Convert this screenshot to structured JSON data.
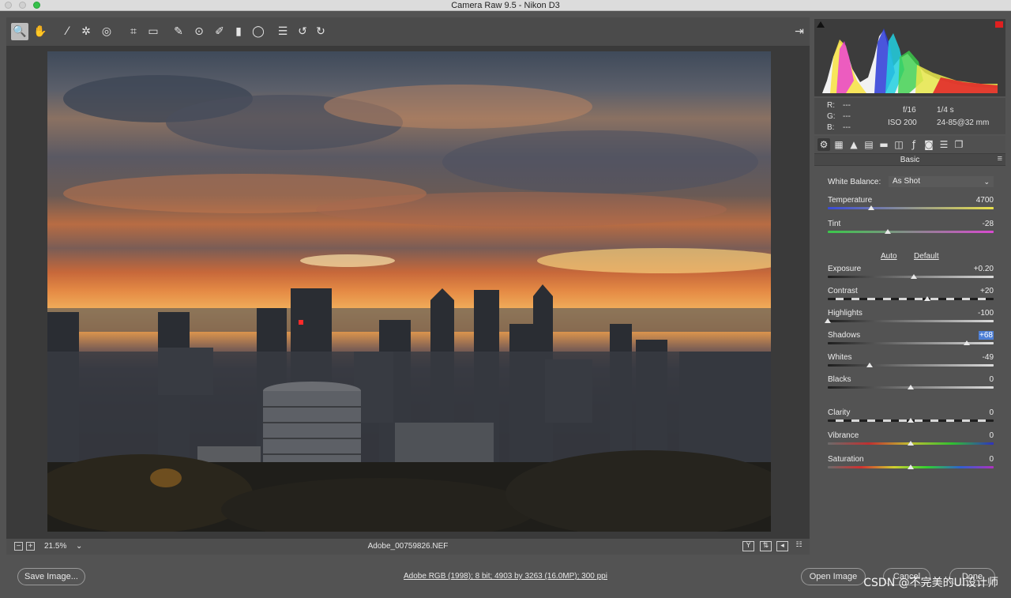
{
  "window": {
    "title": "Camera Raw 9.5  -  Nikon D3"
  },
  "toolbar": {
    "tools": [
      {
        "name": "zoom-tool",
        "glyph": "🔍"
      },
      {
        "name": "hand-tool",
        "glyph": "✋"
      },
      {
        "name": "white-balance-tool",
        "glyph": "⁄"
      },
      {
        "name": "color-sampler-tool",
        "glyph": "✲"
      },
      {
        "name": "targeted-adjustment-tool",
        "glyph": "◎"
      },
      {
        "name": "crop-tool",
        "glyph": "⌗"
      },
      {
        "name": "straighten-tool",
        "glyph": "▭"
      },
      {
        "name": "spot-removal-tool",
        "glyph": "✎"
      },
      {
        "name": "red-eye-tool",
        "glyph": "⊙"
      },
      {
        "name": "adjustment-brush-tool",
        "glyph": "✐"
      },
      {
        "name": "graduated-filter-tool",
        "glyph": "▮"
      },
      {
        "name": "radial-filter-tool",
        "glyph": "◯"
      },
      {
        "name": "preferences-tool",
        "glyph": "☰"
      },
      {
        "name": "rotate-left-tool",
        "glyph": "↺"
      },
      {
        "name": "rotate-right-tool",
        "glyph": "↻"
      }
    ],
    "export_glyph": "⇥"
  },
  "canvas_bar": {
    "zoom": "21.5%",
    "filename": "Adobe_00759826.NEF",
    "view_buttons": [
      "Y",
      "⇅",
      "◂",
      "☷"
    ]
  },
  "info": {
    "r_label": "R:",
    "r_value": "---",
    "g_label": "G:",
    "g_value": "---",
    "b_label": "B:",
    "b_value": "---",
    "aperture": "f/16",
    "shutter": "1/4 s",
    "iso": "ISO 200",
    "lens": "24-85@32 mm"
  },
  "panel": {
    "section_title": "Basic",
    "white_balance_label": "White Balance:",
    "white_balance_value": "As Shot",
    "auto_label": "Auto",
    "default_label": "Default",
    "sliders": [
      {
        "label": "Temperature",
        "value": "4700",
        "pos": 0.26
      },
      {
        "label": "Tint",
        "value": "-28",
        "pos": 0.36
      },
      {
        "label": "Exposure",
        "value": "+0.20",
        "pos": 0.52
      },
      {
        "label": "Contrast",
        "value": "+20",
        "pos": 0.6
      },
      {
        "label": "Highlights",
        "value": "-100",
        "pos": 0.0
      },
      {
        "label": "Shadows",
        "value": "+68",
        "pos": 0.84
      },
      {
        "label": "Whites",
        "value": "-49",
        "pos": 0.25
      },
      {
        "label": "Blacks",
        "value": "0",
        "pos": 0.5
      },
      {
        "label": "Clarity",
        "value": "0",
        "pos": 0.5
      },
      {
        "label": "Vibrance",
        "value": "0",
        "pos": 0.5
      },
      {
        "label": "Saturation",
        "value": "0",
        "pos": 0.5
      }
    ]
  },
  "footer": {
    "save_label": "Save Image...",
    "workflow": "Adobe RGB (1998); 8 bit; 4903 by 3263 (16.0MP); 300 ppi",
    "open_label": "Open Image",
    "cancel_label": "Cancel",
    "done_label": "Done",
    "watermark": "CSDN @不完美的UI设计师"
  },
  "colors": {
    "panel_bg": "#535353",
    "canvas_bg": "#3a3a3a",
    "accent_selection": "#4d7fd6",
    "zoom_traffic_light": "#35c14a"
  }
}
